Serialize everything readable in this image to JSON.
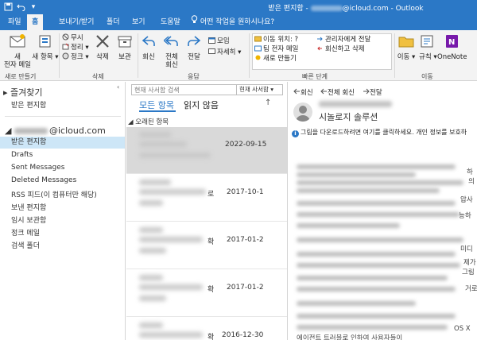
{
  "titlebar": {
    "title_prefix": "받은 편지함 - ",
    "title_domain": "@icloud.com",
    "title_suffix": " - Outlook"
  },
  "tabs": [
    {
      "label": "파일"
    },
    {
      "label": "홈"
    },
    {
      "label": "보내기/받기"
    },
    {
      "label": "폴더"
    },
    {
      "label": "보기"
    },
    {
      "label": "도움말"
    }
  ],
  "tell_me": "어떤 작업을 원하시나요?",
  "ribbon": {
    "new_email": "새\n전자 메일",
    "new_items": "새 항목",
    "group_new": "새로 만들기",
    "ignore": "무시",
    "cleanup": "정리",
    "junk": "정크",
    "delete": "삭제",
    "archive": "보관",
    "group_delete": "삭제",
    "reply": "회신",
    "reply_all": "전체\n회신",
    "forward": "전달",
    "meeting": "모임",
    "more": "자세히",
    "group_respond": "응답",
    "quick_steps": [
      "이동 위치: ?",
      "팀 전자 메일",
      "새로 만들기",
      "관리자에게 전달",
      "회신하고 삭제"
    ],
    "group_quick": "빠른 단계",
    "move": "이동",
    "rules": "규칙",
    "onenote": "OneNote",
    "group_move": "이동"
  },
  "folders": {
    "favorites": "즐겨찾기",
    "fav_inbox": "받은 편지함",
    "account_domain": "@icloud.com",
    "items": [
      "받은 편지함",
      "Drafts",
      "Sent Messages",
      "Deleted Messages",
      "RSS 피드(이 컴퓨터만 해당)",
      "보낸 편지함",
      "임시 보관함",
      "정크 메일",
      "검색 폴더"
    ]
  },
  "list": {
    "search_placeholder": "현재 사서함 검색",
    "scope": "현재 사서함",
    "filter_all": "모든 항목",
    "filter_unread": "읽지 않음",
    "group": "오래된 항목",
    "messages": [
      {
        "date": "2022-09-15",
        "snippet": ""
      },
      {
        "date": "2017-10-1",
        "snippet": "로"
      },
      {
        "date": "2017-01-2",
        "snippet": "확"
      },
      {
        "date": "2017-01-2",
        "snippet": "확"
      },
      {
        "date": "2016-12-30",
        "snippet": "확"
      }
    ]
  },
  "reading": {
    "reply": "회신",
    "reply_all": "전체 회신",
    "forward": "전달",
    "subject": "시놀로지 솔루션",
    "info": "그림을 다운로드하려면 여기를 클릭하세요. 개인 정보를 보호하",
    "tails": [
      "하",
      "의",
      "압사",
      "능하",
      "미디",
      "제가",
      "그림",
      "거로",
      "OS X",
      "에이전트 트러블로 인하여 사용자들이"
    ]
  },
  "colors": {
    "accent": "#2b78c6",
    "selected_row": "#d9d9d9",
    "selected_folder": "#cde6f7"
  }
}
